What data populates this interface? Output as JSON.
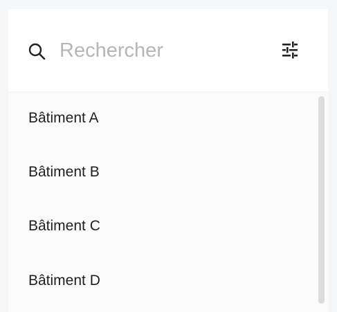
{
  "search": {
    "placeholder": "Rechercher",
    "value": ""
  },
  "buildings": [
    {
      "label": "Bâtiment A"
    },
    {
      "label": "Bâtiment B"
    },
    {
      "label": "Bâtiment C"
    },
    {
      "label": "Bâtiment D"
    }
  ],
  "icons": {
    "search": "search-icon",
    "filter": "tune-sliders-icon"
  },
  "colors": {
    "page_background": "#f5f6f8",
    "search_background": "#ffffff",
    "list_background": "#fbfbfb",
    "text": "#1f1f1f",
    "placeholder": "#b6b6b6",
    "scrollbar": "#dcdcdc"
  }
}
